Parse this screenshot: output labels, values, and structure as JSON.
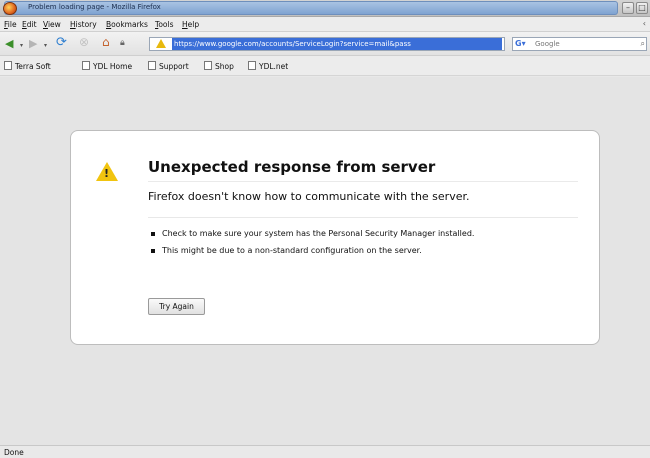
{
  "window": {
    "title": "Problem loading page - Mozilla Firefox",
    "buttons": [
      "–",
      "□"
    ]
  },
  "menu": {
    "items": [
      "File",
      "Edit",
      "View",
      "History",
      "Bookmarks",
      "Tools",
      "Help"
    ],
    "overflow": "‹"
  },
  "navbar": {
    "url": "https://www.google.com/accounts/ServiceLogin?service=mail&pass",
    "search_placeholder": "Google"
  },
  "bookmarks": {
    "items": [
      "Terra Soft",
      "YDL Home",
      "Support",
      "Shop",
      "YDL.net"
    ]
  },
  "error_page": {
    "title": "Unexpected response from server",
    "short_desc": "Firefox doesn't know how to communicate with the server.",
    "details": [
      "Check to make sure your system has the Personal Security Manager installed.",
      "This might be due to a non-standard configuration on the server."
    ],
    "retry_label": "Try Again"
  },
  "status": {
    "text": "Done"
  },
  "colors": {
    "accent": "#3a6ed8",
    "warning": "#f1c40f"
  }
}
